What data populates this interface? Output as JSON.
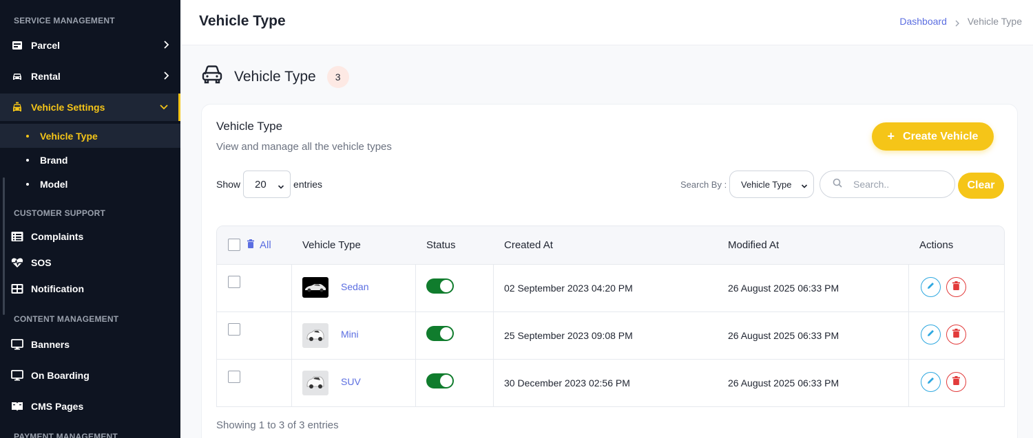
{
  "sidebar": {
    "sections": {
      "service": "SERVICE MANAGEMENT",
      "support": "CUSTOMER SUPPORT",
      "content": "CONTENT MANAGEMENT",
      "payment": "PAYMENT MANAGEMENT"
    },
    "items": {
      "parcel": "Parcel",
      "rental": "Rental",
      "vehicle_settings": "Vehicle Settings",
      "complaints": "Complaints",
      "sos": "SOS",
      "notification": "Notification",
      "banners": "Banners",
      "onboarding": "On Boarding",
      "cms": "CMS Pages"
    },
    "subitems": {
      "vehicle_type": "Vehicle Type",
      "brand": "Brand",
      "model": "Model"
    }
  },
  "header": {
    "title": "Vehicle Type",
    "breadcrumb": {
      "home": "Dashboard",
      "current": "Vehicle Type"
    }
  },
  "section": {
    "title": "Vehicle Type",
    "count": "3"
  },
  "card": {
    "title": "Vehicle Type",
    "subtitle": "View and manage all the vehicle types",
    "create_label": "Create Vehicle",
    "show_label": "Show",
    "entries_value": "20",
    "entries_label": "entries",
    "search_by_label": "Search By :",
    "search_by_value": "Vehicle Type",
    "search_placeholder": "Search..",
    "clear_label": "Clear"
  },
  "table": {
    "columns": {
      "all": "All",
      "vehicle_type": "Vehicle Type",
      "status": "Status",
      "created": "Created At",
      "modified": "Modified At",
      "actions": "Actions"
    },
    "rows": [
      {
        "name": "Sedan",
        "status": "active",
        "created": "02 September 2023 04:20 PM",
        "modified": "26 August 2025 06:33 PM"
      },
      {
        "name": "Mini",
        "status": "active",
        "created": "25 September 2023 09:08 PM",
        "modified": "26 August 2025 06:33 PM"
      },
      {
        "name": "SUV",
        "status": "active",
        "created": "30 December 2023 02:56 PM",
        "modified": "26 August 2025 06:33 PM"
      }
    ],
    "footer": "Showing 1 to 3 of 3 entries"
  },
  "colors": {
    "accent": "#f5c518",
    "sidebar_bg": "#0e1421",
    "link": "#5b6ee1",
    "toggle_on": "#107c2d",
    "edit": "#2fa8e0",
    "delete": "#e23b3b"
  }
}
